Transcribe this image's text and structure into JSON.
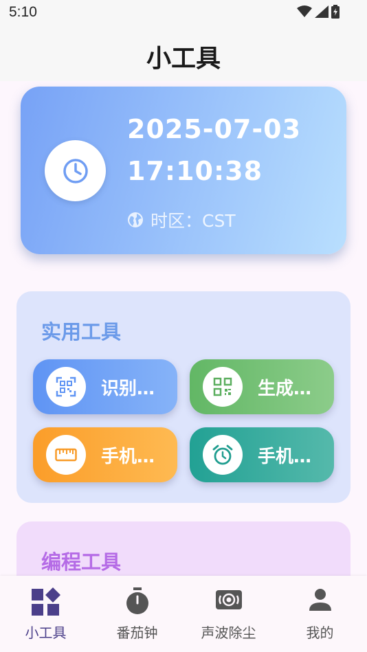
{
  "status_bar": {
    "time": "5:10"
  },
  "app_bar": {
    "title": "小工具"
  },
  "clock_card": {
    "date": "2025-07-03",
    "time": "17:10:38",
    "timezone_label": "时区：CST"
  },
  "utility_section": {
    "title": "实用工具",
    "buttons": [
      {
        "label": "识别…",
        "icon": "qr-scan-icon",
        "color": "#5f94f4"
      },
      {
        "label": "生成…",
        "icon": "qr-code-icon",
        "color": "#62b765"
      },
      {
        "label": "手机…",
        "icon": "ruler-icon",
        "color": "#fb9d29"
      },
      {
        "label": "手机…",
        "icon": "alarm-clock-icon",
        "color": "#22a194"
      }
    ]
  },
  "programming_section": {
    "title": "编程工具"
  },
  "bottom_nav": {
    "items": [
      {
        "label": "小工具",
        "icon": "widgets-icon",
        "active": true
      },
      {
        "label": "番茄钟",
        "icon": "timer-icon",
        "active": false
      },
      {
        "label": "声波除尘",
        "icon": "speaker-icon",
        "active": false
      },
      {
        "label": "我的",
        "icon": "person-icon",
        "active": false
      }
    ]
  },
  "colors": {
    "accent": "#4b3f8a",
    "utility_title": "#6b9ae9",
    "programming_title": "#b56be6"
  }
}
